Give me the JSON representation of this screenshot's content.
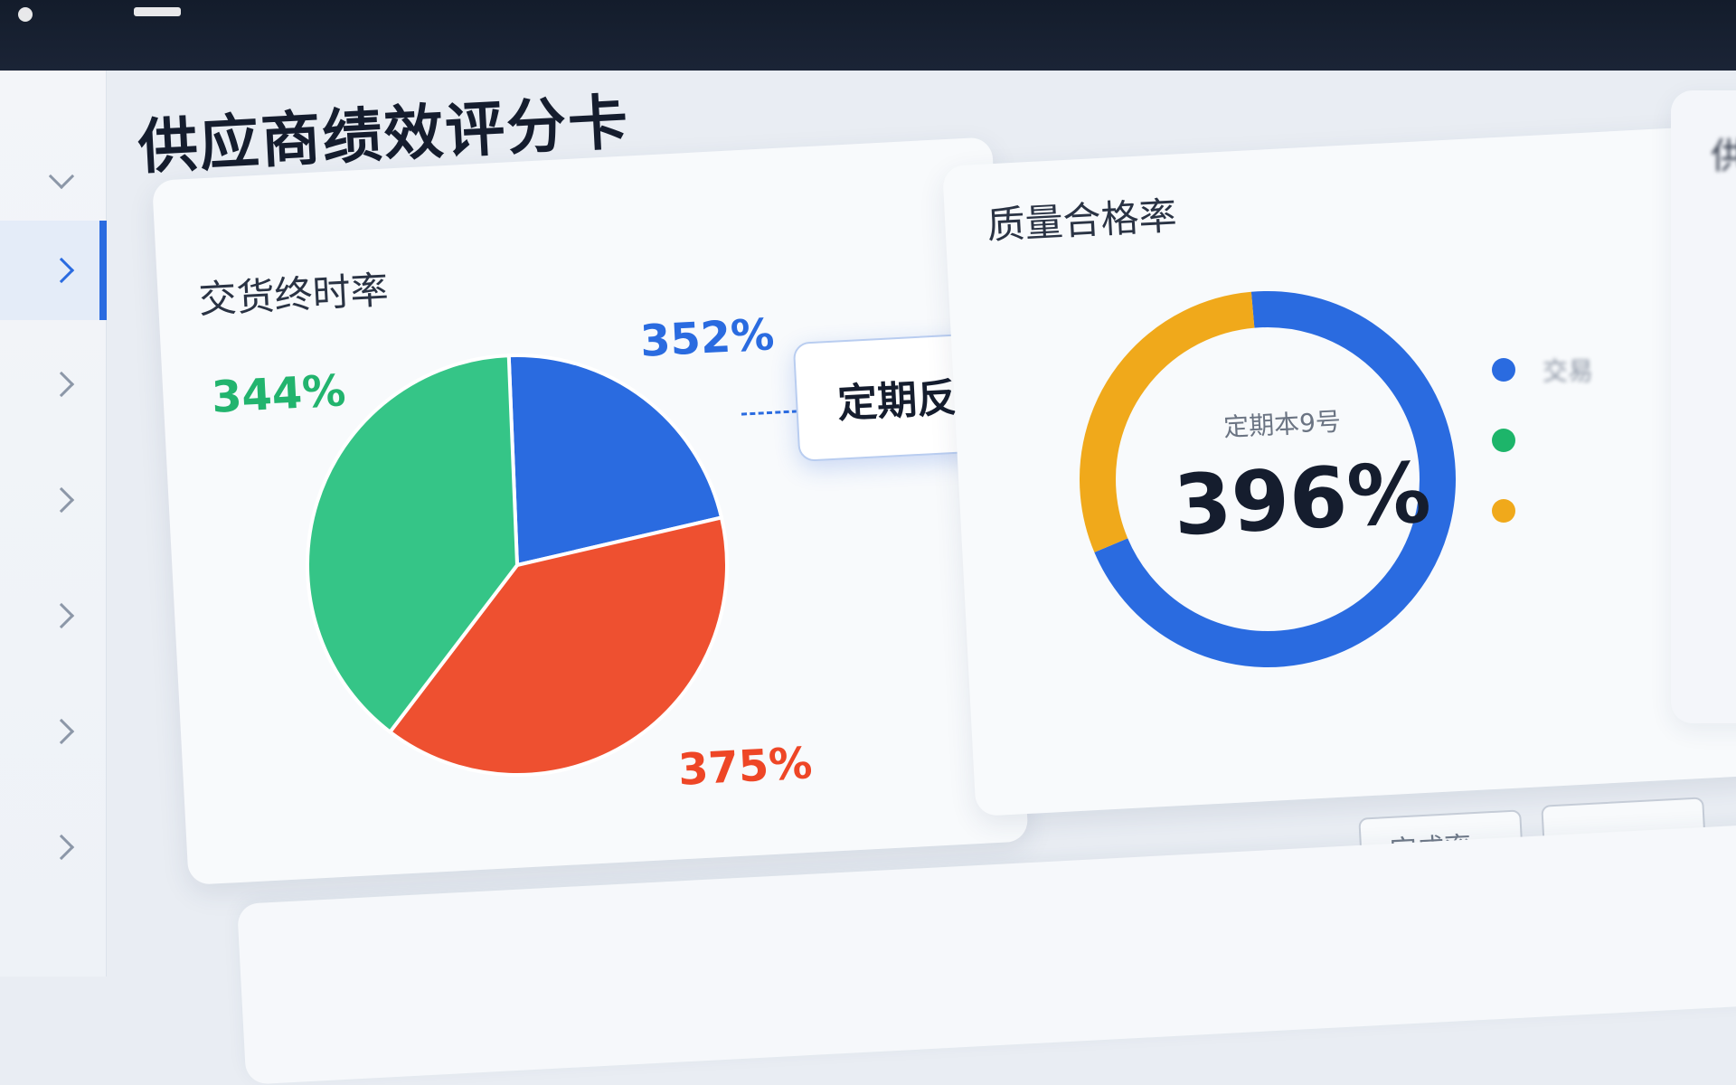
{
  "page": {
    "title": "供应商绩效评分卡"
  },
  "sidebar": {
    "items": [
      {
        "label": "",
        "icon": "chevron-down-icon",
        "active": false
      },
      {
        "label": "",
        "icon": "chevron-right-icon",
        "active": true
      },
      {
        "label": "",
        "icon": "chevron-right-icon",
        "active": false
      },
      {
        "label": "",
        "icon": "chevron-right-icon",
        "active": false
      },
      {
        "label": "",
        "icon": "chevron-right-icon",
        "active": false
      },
      {
        "label": "",
        "icon": "chevron-right-icon",
        "active": false
      },
      {
        "label": "",
        "icon": "chevron-right-icon",
        "active": false
      }
    ]
  },
  "pie_card": {
    "title": "交货终时率",
    "tooltip": "定期反馈"
  },
  "donut_card": {
    "title": "质量合格率",
    "center_sub": "定期本9号",
    "center_value": "396%",
    "legend": [
      {
        "label": "交易",
        "color": "#2a6be0"
      },
      {
        "label": "",
        "color": "#1db56a"
      },
      {
        "label": "",
        "color": "#f0a91b"
      }
    ]
  },
  "toolbar": {
    "status_filter_label": "完成率",
    "secondary_button_label": ""
  },
  "bottom_section": {
    "title": ""
  },
  "right_panel": {
    "title": "供"
  },
  "colors": {
    "blue": "#2a6be0",
    "red": "#ee5030",
    "green": "#35c587",
    "amber": "#f0a91b",
    "title": "#151d2e"
  },
  "chart_data": [
    {
      "type": "pie",
      "title": "交货终时率",
      "slices": [
        {
          "label": "352%",
          "value": 22,
          "color": "#2a6be0"
        },
        {
          "label": "375%",
          "value": 39,
          "color": "#ee5030"
        },
        {
          "label": "344%",
          "value": 39,
          "color": "#35c587"
        }
      ]
    },
    {
      "type": "pie",
      "title": "质量合格率",
      "donut": true,
      "slices": [
        {
          "label": "",
          "value": 70,
          "color": "#2a6be0"
        },
        {
          "label": "",
          "value": 30,
          "color": "#f0a91b"
        }
      ],
      "center_label": "396%"
    }
  ]
}
